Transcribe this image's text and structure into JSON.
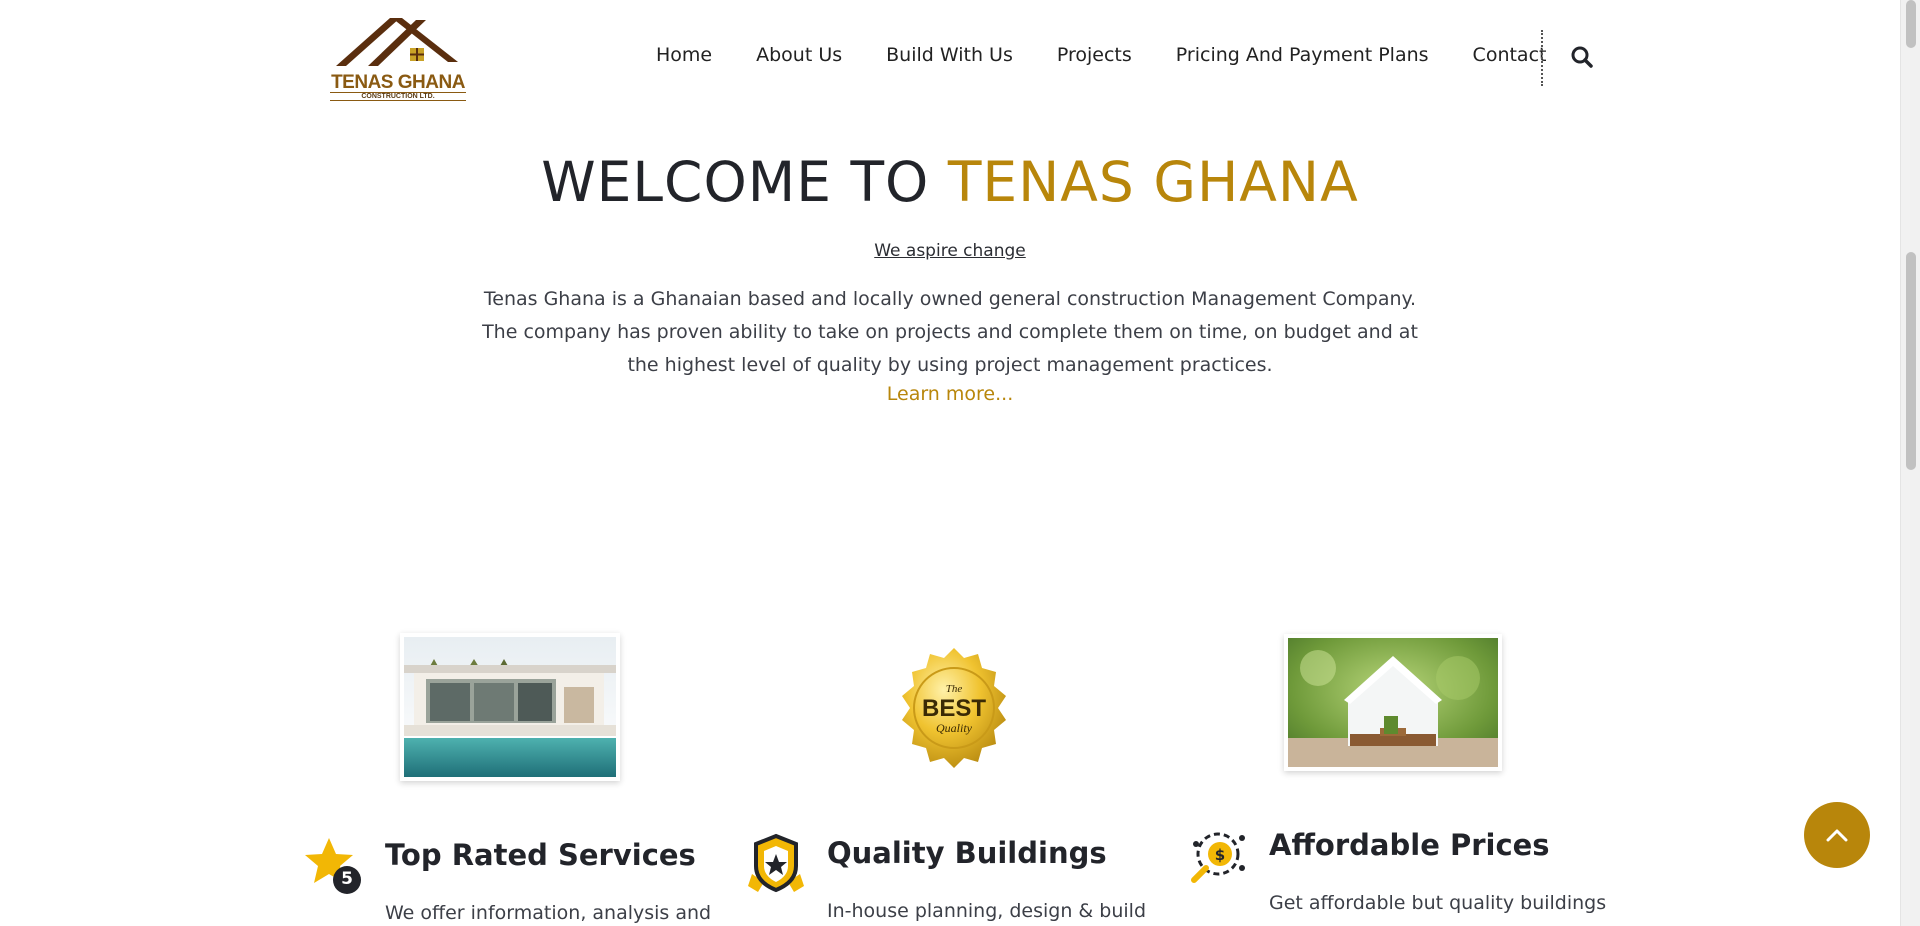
{
  "brand": {
    "name": "TENAS GHANA",
    "subtitle": "CONSTRUCTION LTD.",
    "colors": {
      "accent": "#b8860b",
      "dark": "#22242a",
      "logo_brown": "#5a2e0e"
    }
  },
  "nav": {
    "items": [
      {
        "label": "Home"
      },
      {
        "label": "About Us"
      },
      {
        "label": "Build With Us"
      },
      {
        "label": "Projects"
      },
      {
        "label": "Pricing And Payment Plans"
      },
      {
        "label": "Contact"
      }
    ],
    "search_icon": "search-icon"
  },
  "welcome": {
    "title_prefix": "WELCOME TO ",
    "title_accent": "TENAS GHANA",
    "tagline": "We aspire change",
    "intro": "Tenas Ghana is a Ghanaian based and locally owned general construction Management Company. The company has proven ability to take on projects and complete them on time, on budget and at the highest level of quality by using project management practices.",
    "learn_more": "Learn more..."
  },
  "features": [
    {
      "title": "Top Rated Services",
      "text": "We offer information, analysis and",
      "icon": "star-five-icon",
      "badge_number": "5"
    },
    {
      "title": "Quality Buildings",
      "text": "In-house planning, design & build",
      "icon": "shield-star-icon"
    },
    {
      "title": "Affordable Prices",
      "text": "Get affordable but quality buildings",
      "icon": "money-gear-icon"
    }
  ],
  "best_quality_badge": {
    "line1": "The",
    "line2": "BEST",
    "line3": "Quality"
  },
  "scroll_top_icon": "chevron-up-icon"
}
